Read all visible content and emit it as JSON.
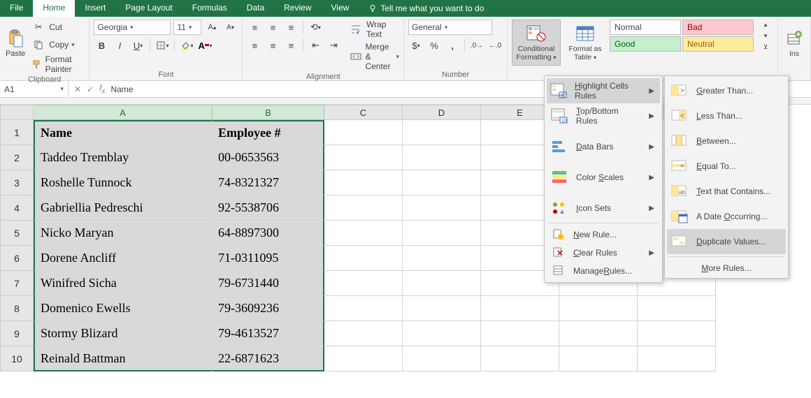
{
  "tabs": {
    "file": "File",
    "home": "Home",
    "insert": "Insert",
    "page_layout": "Page Layout",
    "formulas": "Formulas",
    "data": "Data",
    "review": "Review",
    "view": "View",
    "tell_me": "Tell me what you want to do"
  },
  "clipboard": {
    "paste": "Paste",
    "cut": "Cut",
    "copy": "Copy",
    "format_painter": "Format Painter",
    "title": "Clipboard"
  },
  "font": {
    "name": "Georgia",
    "size": "11",
    "title": "Font"
  },
  "alignment": {
    "wrap": "Wrap Text",
    "merge": "Merge & Center",
    "title": "Alignment"
  },
  "number": {
    "format": "General",
    "title": "Number"
  },
  "styles": {
    "conditional": "Conditional Formatting",
    "format_table": "Format as Table",
    "normal": "Normal",
    "bad": "Bad",
    "good": "Good",
    "neutral": "Neutral"
  },
  "insert_group": "Ins",
  "name_box": "A1",
  "formula_value": "Name",
  "columns": [
    "A",
    "B",
    "C",
    "D",
    "E"
  ],
  "row_headers": [
    1,
    2,
    3,
    4,
    5,
    6,
    7,
    8,
    9,
    10
  ],
  "data_rows": [
    {
      "a": "Name",
      "b": "Employee #"
    },
    {
      "a": "Taddeo Tremblay",
      "b": "00-0653563"
    },
    {
      "a": "Roshelle Tunnock",
      "b": "74-8321327"
    },
    {
      "a": "Gabriellia Pedreschi",
      "b": "92-5538706"
    },
    {
      "a": "Nicko Maryan",
      "b": "64-8897300"
    },
    {
      "a": "Dorene Ancliff",
      "b": "71-0311095"
    },
    {
      "a": "Winifred Sicha",
      "b": "79-6731440"
    },
    {
      "a": "Domenico Ewells",
      "b": "79-3609236"
    },
    {
      "a": "Stormy Blizard",
      "b": "79-4613527"
    },
    {
      "a": "Reinald Battman",
      "b": "22-6871623"
    }
  ],
  "cf_menu": {
    "highlight": "Highlight Cells Rules",
    "topbottom": "Top/Bottom Rules",
    "databars": "Data Bars",
    "colorscales": "Color Scales",
    "iconsets": "Icon Sets",
    "new_rule": "New Rule...",
    "clear": "Clear Rules",
    "manage": "Manage Rules..."
  },
  "hl_menu": {
    "greater": "Greater Than...",
    "less": "Less Than...",
    "between": "Between...",
    "equal": "Equal To...",
    "text": "Text that Contains...",
    "date": "A Date Occurring...",
    "dup": "Duplicate Values...",
    "more": "More Rules..."
  }
}
